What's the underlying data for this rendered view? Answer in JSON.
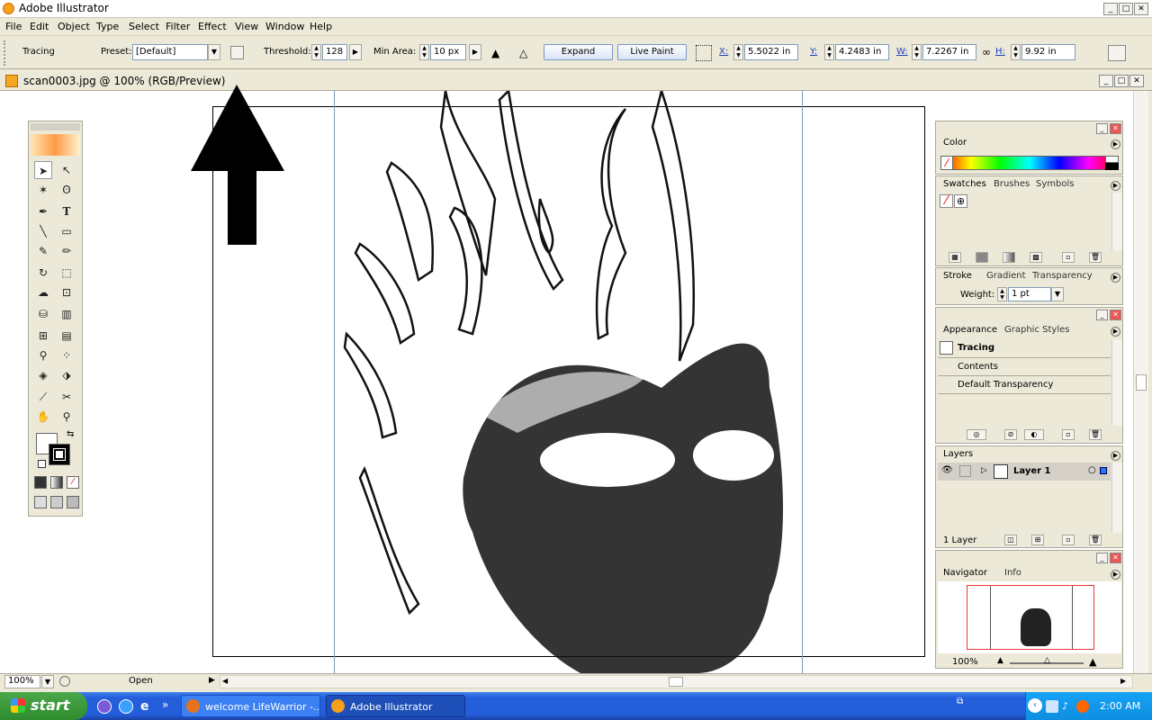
{
  "window": {
    "title": "Adobe Illustrator",
    "doc_title": "scan0003.jpg @ 100% (RGB/Preview)"
  },
  "menu": [
    "File",
    "Edit",
    "Object",
    "Type",
    "Select",
    "Filter",
    "Effect",
    "View",
    "Window",
    "Help"
  ],
  "control": {
    "mode": "Tracing",
    "preset_label": "Preset:",
    "preset_value": "[Default]",
    "threshold_label": "Threshold:",
    "threshold_value": "128",
    "minarea_label": "Min Area:",
    "minarea_value": "10 px",
    "expand_label": "Expand",
    "livepaint_label": "Live Paint",
    "x_label": "X:",
    "x_value": "5.5022 in",
    "y_label": "Y:",
    "y_value": "4.2483 in",
    "w_label": "W:",
    "w_value": "7.2267 in",
    "h_label": "H:",
    "h_value": "9.92 in"
  },
  "panels": {
    "color": {
      "tab": "Color"
    },
    "swatches": {
      "tabs": [
        "Swatches",
        "Brushes",
        "Symbols"
      ]
    },
    "stroke": {
      "tabs": [
        "Stroke",
        "Gradient",
        "Transparency"
      ],
      "weight_label": "Weight:",
      "weight_value": "1 pt"
    },
    "appearance": {
      "tabs": [
        "Appearance",
        "Graphic Styles"
      ],
      "item": "Tracing",
      "rows": [
        "Contents",
        "Default Transparency"
      ]
    },
    "layers": {
      "tab": "Layers",
      "layer_name": "Layer 1",
      "count": "1 Layer"
    },
    "navigator": {
      "tabs": [
        "Navigator",
        "Info"
      ],
      "zoom": "100%"
    }
  },
  "status": {
    "zoom": "100%",
    "state": "Open"
  },
  "taskbar": {
    "start": "start",
    "tasks": [
      "welcome LifeWarrior -...",
      "Adobe Illustrator"
    ],
    "time": "2:00 AM"
  },
  "colors": {
    "accent": "#245edb",
    "panel": "#ece9d8",
    "guide": "#7b9dbf"
  }
}
